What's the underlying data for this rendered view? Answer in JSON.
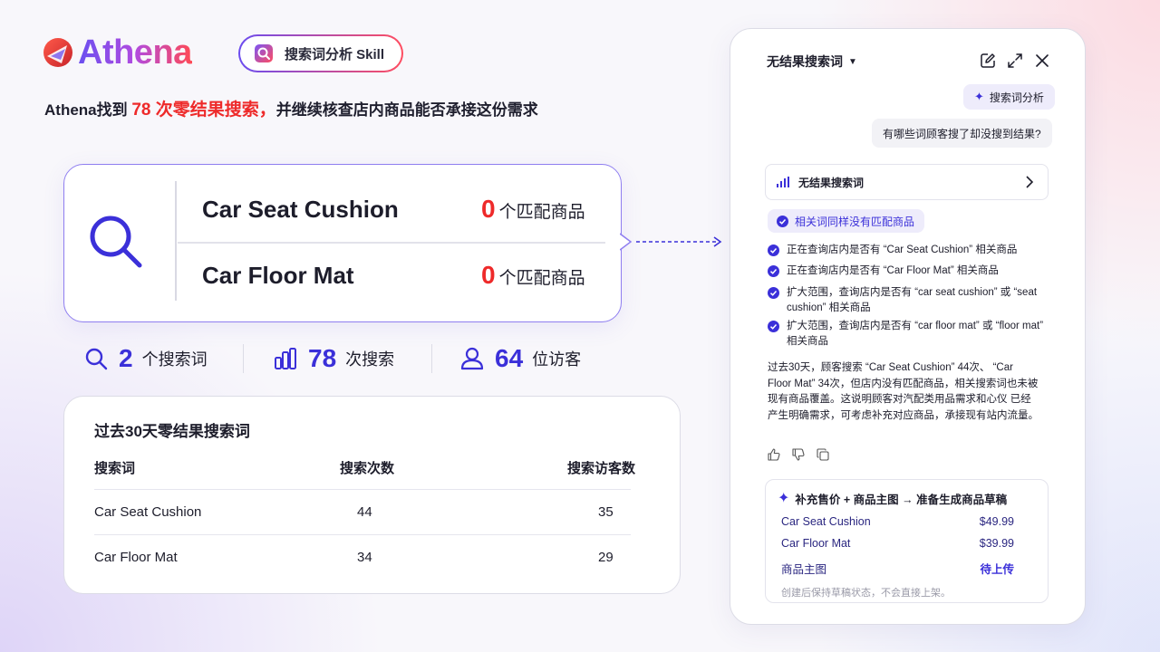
{
  "brand": {
    "name": "Athena",
    "accent_gradient": [
      "#6a4ff0",
      "#b14be0",
      "#ff4a55"
    ]
  },
  "skill_pill": {
    "label": "搜索词分析 Skill",
    "icon": "search-doc-icon"
  },
  "headline": {
    "prefix": "Athena找到 ",
    "highlight": "78 次零结果搜索，",
    "suffix": "并继续核查店内商品能否承接这份需求"
  },
  "search_card": {
    "icon": "search-icon",
    "keywords": [
      {
        "term": "Car Seat Cushion",
        "count": "0",
        "unit": "个匹配商品"
      },
      {
        "term": "Car Floor Mat",
        "count": "0",
        "unit": "个匹配商品"
      }
    ]
  },
  "stats": [
    {
      "icon": "search-icon",
      "value": "2",
      "label": "个搜索词"
    },
    {
      "icon": "bar-chart-icon",
      "value": "78",
      "label": "次搜索"
    },
    {
      "icon": "user-icon",
      "value": "64",
      "label": "位访客"
    }
  ],
  "table": {
    "title": "过去30天零结果搜索词",
    "columns": [
      "搜索词",
      "搜索次数",
      "搜索访客数"
    ],
    "rows": [
      [
        "Car Seat Cushion",
        "44",
        "35"
      ],
      [
        "Car Floor Mat",
        "34",
        "29"
      ]
    ]
  },
  "panel": {
    "title": "无结果搜索词",
    "skill_chip": "搜索词分析",
    "user_message": "有哪些词顾客搜了却没搜到结果?",
    "result_row": "无结果搜索词",
    "status_chip": "相关词同样没有匹配商品",
    "steps": [
      "正在查询店内是否有 “Car Seat Cushion” 相关商品",
      "正在查询店内是否有 “Car Floor Mat” 相关商品",
      "扩大范围，查询店内是否有 “car seat cushion” 或 “seat cushion” 相关商品",
      "扩大范围，查询店内是否有 “car floor mat” 或 “floor mat” 相关商品"
    ],
    "summary": "过去30天，顾客搜索 “Car Seat Cushion” 44次、 “Car Floor Mat” 34次，但店内没有匹配商品，相关搜索词也未被现有商品覆盖。这说明顾客对汽配类用品需求和心仪 已经产生明确需求，可考虑补充对应商品，承接现有站内流量。",
    "action": {
      "title": "补充售价 + 商品主图 → 准备生成商品草稿",
      "items": [
        {
          "label": "Car Seat Cushion",
          "value": "$49.99"
        },
        {
          "label": "Car Floor Mat",
          "value": "$39.99"
        },
        {
          "label": "商品主图",
          "value": "待上传"
        }
      ],
      "note": "创建后保持草稿状态，不会直接上架。"
    }
  },
  "colors": {
    "accent": "#3b30d9",
    "highlight_red": "#ee2a2a"
  }
}
